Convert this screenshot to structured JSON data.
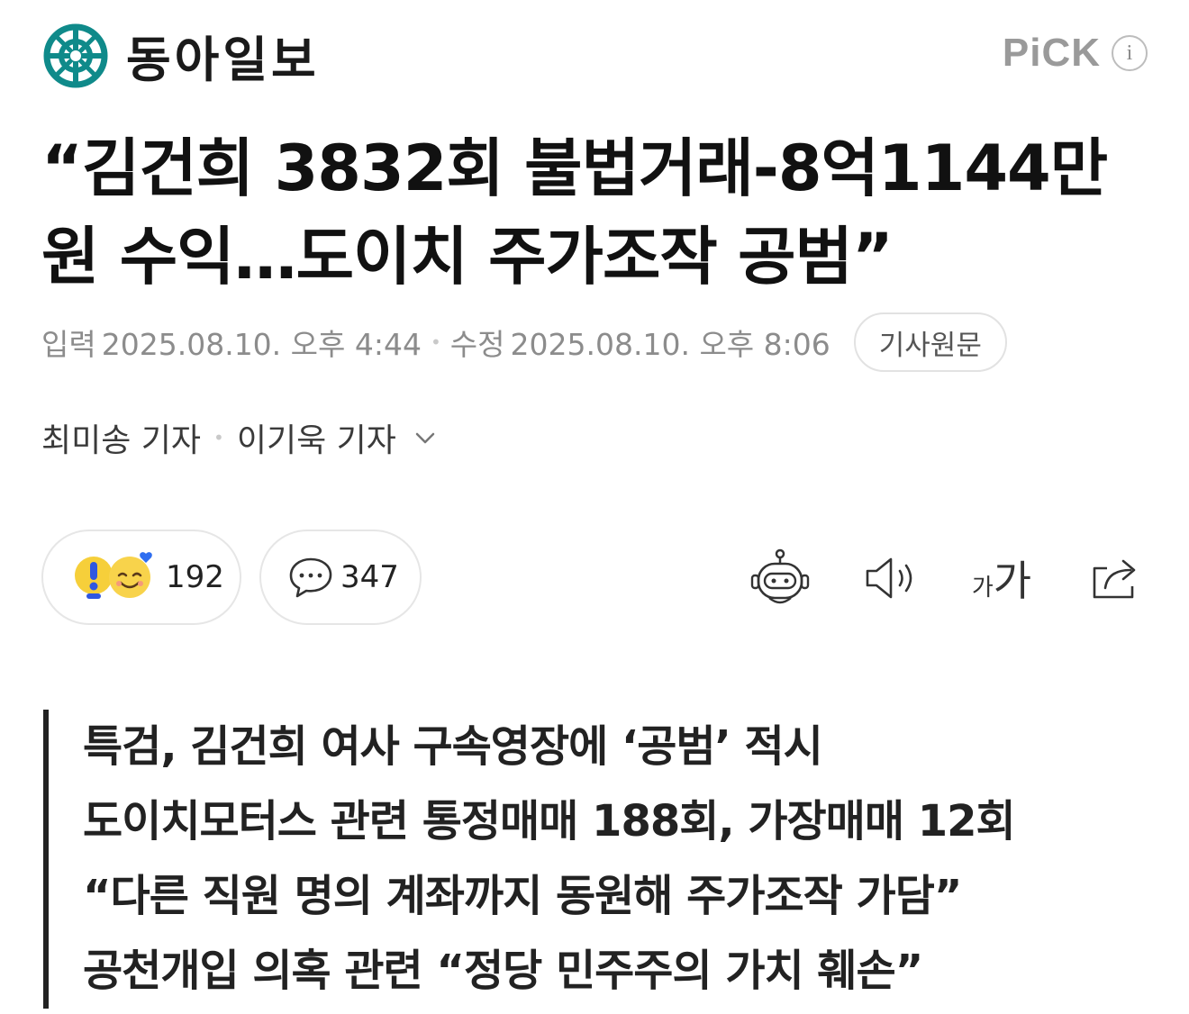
{
  "header": {
    "brand": "동아일보",
    "pick": "PiCK",
    "info_icon": "info-icon",
    "logo_icon": "donga-logo-icon"
  },
  "article": {
    "title": "“김건희 3832회 불법거래-8억1144만원 수익…도이치 주가조작 공범”",
    "input_label": "입력",
    "input_time": "2025.08.10. 오후 4:44",
    "edit_label": "수정",
    "edit_time": "2025.08.10. 오후 8:06",
    "original_button": "기사원문",
    "reporters": [
      "최미송 기자",
      "이기욱 기자"
    ]
  },
  "actions": {
    "reaction_count": "192",
    "comment_count": "347",
    "font_small": "가",
    "font_large": "가",
    "icons": [
      "reaction-emoji-icon",
      "comment-icon",
      "robot-summary-icon",
      "speaker-icon",
      "font-size-icon",
      "share-icon"
    ]
  },
  "summary": [
    "특검, 김건희 여사 구속영장에 ‘공범’ 적시",
    "도이치모터스 관련 통정매매 188회, 가장매매 12회",
    "“다른 직원 명의 계좌까지 동원해 주가조작 가담”",
    "공천개입 의혹 관련 “정당 민주주의 가치 훼손”"
  ],
  "colors": {
    "brand": "#0f8a8a",
    "text": "#111111",
    "muted": "#8c8c8c",
    "pick": "#9a9a9a"
  }
}
